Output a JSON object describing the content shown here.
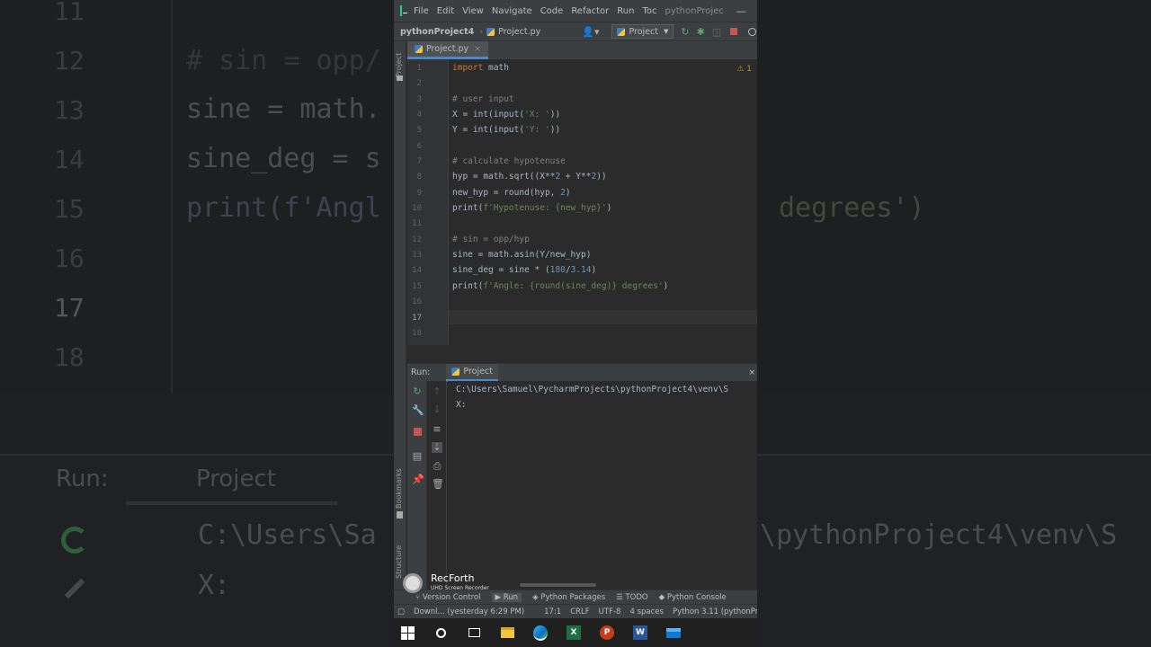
{
  "window": {
    "menu": [
      "File",
      "Edit",
      "View",
      "Navigate",
      "Code",
      "Refactor",
      "Run",
      "Toc"
    ],
    "title": "pythonProjec",
    "minimize": "—"
  },
  "navbar": {
    "project": "pythonProject4",
    "file": "Project.py",
    "run_config": "Project"
  },
  "tabs": [
    {
      "label": "Project.py",
      "close": "×"
    }
  ],
  "editor": {
    "warning": "⚠ 1",
    "line_numbers": [
      "1",
      "2",
      "3",
      "4",
      "5",
      "6",
      "7",
      "8",
      "9",
      "10",
      "11",
      "12",
      "13",
      "14",
      "15",
      "16",
      "17",
      "18"
    ],
    "lines": [
      "import math",
      "",
      "# user input",
      "X = int(input('X: '))",
      "Y = int(input('Y: '))",
      "",
      "# calculate hypotenuse",
      "hyp = math.sqrt((X**2 + Y**2))",
      "new_hyp = round(hyp, 2)",
      "print(f'Hypotenuse: {new_hyp}')",
      "",
      "# sin = opp/hyp",
      "sine = math.asin(Y/new_hyp)",
      "sine_deg = sine * (180/3.14)",
      "print(f'Angle: {round(sine_deg)} degrees')",
      "",
      "",
      ""
    ]
  },
  "run_panel": {
    "label": "Run:",
    "tab": "Project",
    "close": "×",
    "console": [
      "C:\\Users\\Samuel\\PycharmProjects\\pythonProject4\\venv\\S",
      "X:"
    ]
  },
  "left_strip": {
    "project": "Project",
    "bookmarks": "Bookmarks",
    "structure": "Structure"
  },
  "toolwindows": [
    "Version Control",
    "Run",
    "Python Packages",
    "TODO",
    "Python Console"
  ],
  "status": {
    "message": "Downl... (yesterday 6:29 PM)",
    "position": "17:1",
    "line_sep": "CRLF",
    "encoding": "UTF-8",
    "indent": "4 spaces",
    "interpreter": "Python 3.11 (pythonPro"
  },
  "watermark": {
    "name": "RecForth",
    "sub": "UHD Screen Recorder"
  },
  "background": {
    "line_numbers": [
      "11",
      "12",
      "13",
      "14",
      "15",
      "16",
      "17",
      "18"
    ],
    "code": [
      "# sin = opp/",
      "sine = math.",
      "sine_deg = s",
      "print(f'Angl"
    ],
    "code_right": "degrees')",
    "run_label": "Run:",
    "run_tab": "Project",
    "path_left": "C:\\Users\\Sa",
    "path_right": "\\pythonProject4\\venv\\S",
    "x_prompt": "X:"
  },
  "taskbar": {
    "excel": "X",
    "powerpoint": "P",
    "word": "W"
  },
  "colors": {
    "keyword": "#cc7832",
    "comment": "#808080",
    "string": "#6a8759",
    "number": "#6897bb",
    "accent": "#4a88c7"
  }
}
